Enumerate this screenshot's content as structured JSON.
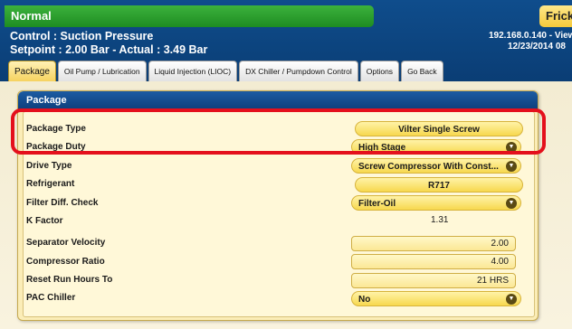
{
  "header": {
    "status": "Normal",
    "brand": "Frick",
    "control": "Control : Suction Pressure",
    "setpoint": "Setpoint : 2.00 Bar - Actual : 3.49 Bar",
    "ip": "192.168.0.140 - View",
    "date": "12/23/2014 08"
  },
  "tabs": [
    {
      "label": "Package"
    },
    {
      "label": "Oil Pump / Lubrication"
    },
    {
      "label": "Liquid Injection (LIOC)"
    },
    {
      "label": "DX Chiller / Pumpdown Control"
    },
    {
      "label": "Options"
    },
    {
      "label": "Go Back"
    }
  ],
  "panel": {
    "title": "Package",
    "rows": {
      "package_type": {
        "label": "Package Type",
        "value": "Vilter Single Screw"
      },
      "package_duty": {
        "label": "Package Duty",
        "value": "High Stage"
      },
      "drive_type": {
        "label": "Drive Type",
        "value": "Screw Compressor With Const..."
      },
      "refrigerant": {
        "label": "Refrigerant",
        "value": "R717"
      },
      "filter_diff_check": {
        "label": "Filter Diff. Check",
        "value": "Filter-Oil"
      },
      "k_factor": {
        "label": "K Factor",
        "value": "1.31"
      },
      "separator_velocity": {
        "label": "Separator Velocity",
        "value": "2.00"
      },
      "compressor_ratio": {
        "label": "Compressor Ratio",
        "value": "4.00"
      },
      "reset_run_hours": {
        "label": "Reset Run Hours To",
        "value": "21 HRS"
      },
      "pac_chiller": {
        "label": "PAC Chiller",
        "value": "No"
      }
    }
  },
  "icons": {
    "dropdown": "chevron-down-icon"
  },
  "colors": {
    "status_green": "#2a9e2e",
    "header_blue": "#0d4584",
    "pill_yellow": "#f7d84e",
    "highlight_red": "#e4101c"
  }
}
